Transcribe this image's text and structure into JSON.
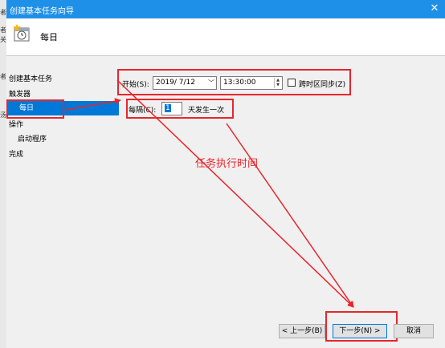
{
  "window": {
    "title": "创建基本任务向导",
    "close_glyph": "✕"
  },
  "header": {
    "page_title": "每日"
  },
  "background_fragments": [
    "者",
    "者",
    "关",
    "者",
    "汤"
  ],
  "nav": {
    "items": [
      {
        "label": "创建基本任务"
      },
      {
        "label": "触发器"
      },
      {
        "label": "每日"
      },
      {
        "label": "操作"
      },
      {
        "label": "启动程序"
      },
      {
        "label": "完成"
      }
    ]
  },
  "form": {
    "start_label": "开始(S):",
    "start_date": "2019/ 7/12",
    "start_time": "13:30:00",
    "sync_timezone_label": "跨时区同步(Z)",
    "sync_timezone_checked": false,
    "recur_label": "每隔(C):",
    "recur_value": "1",
    "recur_suffix": "天发生一次"
  },
  "annotation": {
    "text": "任务执行时间",
    "color": "#e8262b"
  },
  "buttons": {
    "back": "< 上一步(B)",
    "next": "下一步(N) >",
    "cancel": "取消"
  },
  "colors": {
    "titlebar": "#1e90e8",
    "selection": "#0078d7",
    "annotation_red": "#e8262b"
  }
}
